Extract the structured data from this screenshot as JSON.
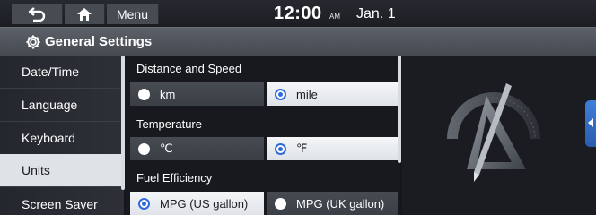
{
  "statusbar": {
    "menu_label": "Menu",
    "time": "12:00",
    "ampm": "AM",
    "date": "Jan. 1"
  },
  "title": "General Settings",
  "left_menu": {
    "items": [
      {
        "label": "Date/Time"
      },
      {
        "label": "Language"
      },
      {
        "label": "Keyboard"
      },
      {
        "label": "Units",
        "selected": true
      },
      {
        "label": "Screen Saver"
      }
    ]
  },
  "units": {
    "distance": {
      "title": "Distance and Speed",
      "options": [
        {
          "label": "km",
          "selected": false
        },
        {
          "label": "mile",
          "selected": true
        }
      ]
    },
    "temperature": {
      "title": "Temperature",
      "options": [
        {
          "label": "℃",
          "selected": false
        },
        {
          "label": "℉",
          "selected": true
        }
      ]
    },
    "fuel": {
      "title": "Fuel Efficiency",
      "options": [
        {
          "label": "MPG (US gallon)",
          "selected": true
        },
        {
          "label": "MPG (UK gallon)",
          "selected": false
        }
      ]
    }
  },
  "colors": {
    "accent": "#2f6bd8",
    "selected_bg": "#dfe3e8",
    "side_tab": "#3f7fd8"
  },
  "icons": {
    "back": "back-arrow-icon",
    "home": "home-icon",
    "title": "gear-icon",
    "side_tab": "chevron-left-icon",
    "illustration": "ruler-protractor-icon"
  }
}
